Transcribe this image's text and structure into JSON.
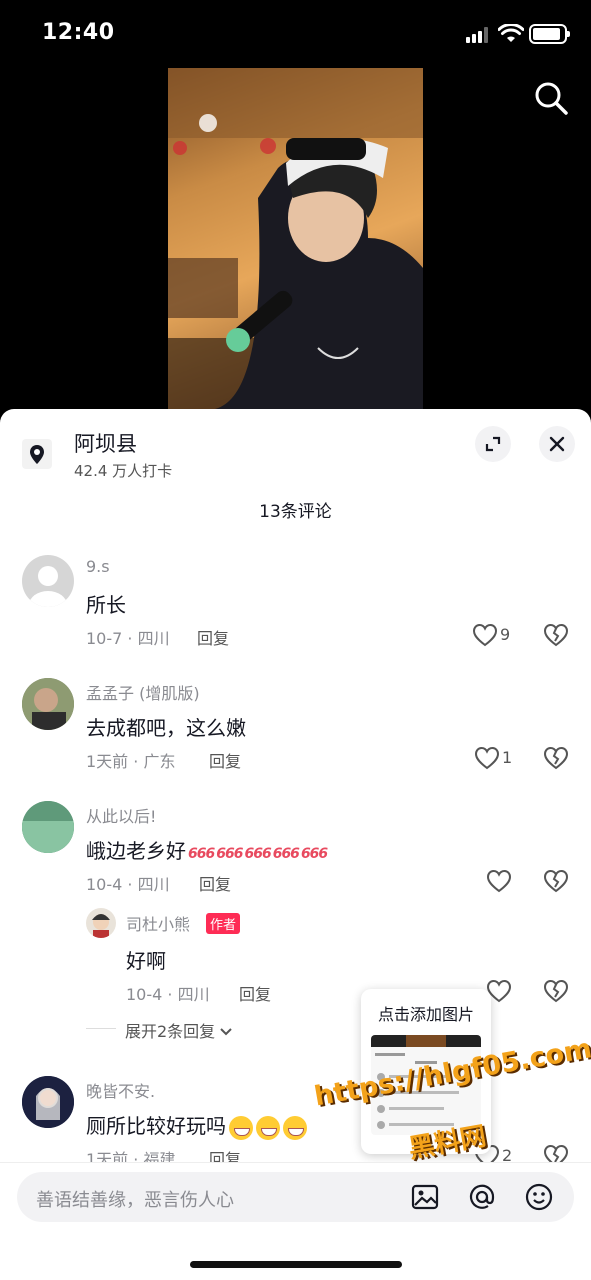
{
  "status_bar": {
    "time": "12:40"
  },
  "location": {
    "name": "阿坝县",
    "checkins": "42.4 万人打卡"
  },
  "comments_header": "13条评论",
  "comments": [
    {
      "user": "9.s",
      "text": "所长",
      "meta": "10-7 · 四川",
      "reply": "回复",
      "likes": "9"
    },
    {
      "user": "孟孟子 (增肌版)",
      "text": "去成都吧，这么嫩",
      "meta": "1天前 · 广东",
      "reply": "回复",
      "likes": "1"
    },
    {
      "user": "从此以后!",
      "text": "峨边老乡好",
      "emoji": "666",
      "meta": "10-4 · 四川",
      "reply": "回复",
      "likes": ""
    },
    {
      "user": "晚皆不安.",
      "text": "厕所比较好玩吗",
      "meta": "1天前 · 福建",
      "reply": "回复",
      "likes": "2"
    }
  ],
  "author_reply": {
    "user": "司杜小熊",
    "badge": "作者",
    "text": "好啊",
    "meta": "10-4 · 四川",
    "reply": "回复"
  },
  "expand_replies": "展开2条回复",
  "tooltip": "点击添加图片",
  "watermark": {
    "url": "https://hlgf05.com",
    "label": "黑料网"
  },
  "input": {
    "placeholder": "善语结善缘，恶言伤人心"
  },
  "icons": [
    "search-icon",
    "location-pin-icon",
    "expand-icon",
    "close-icon",
    "heart-icon",
    "broken-heart-icon",
    "image-icon",
    "at-icon",
    "emoji-icon",
    "chevron-down-icon"
  ],
  "colors": {
    "accent": "#fe2c55",
    "text": "#161823",
    "muted": "#8a8b91",
    "watermark": "#f3a21a"
  }
}
